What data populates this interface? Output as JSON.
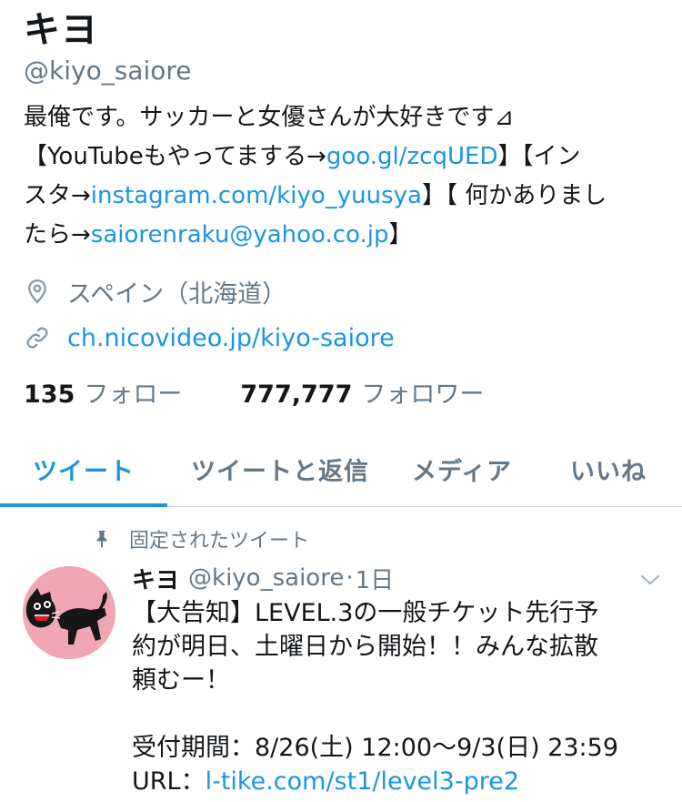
{
  "profile": {
    "display_name": "キヨ",
    "handle": "@kiyo_saiore",
    "bio": {
      "line1": "最俺です。サッカーと女優さんが大好きです⊿",
      "line2_a": "【YouTubeもやってまする→",
      "line2_link": "goo.gl/zcqUED",
      "line2_b": "】【イン",
      "line3_a": "スタ→",
      "line3_link": "instagram.com/kiyo_yuusya",
      "line3_b": "】【 何かありまし",
      "line4_a": "たら→",
      "line4_link": "saiorenraku@yahoo.co.jp",
      "line4_b": "】"
    },
    "location": "スペイン（北海道）",
    "location_icon": "location-pin-icon",
    "website": "ch.nicovideo.jp/kiyo-saiore",
    "website_icon": "link-icon",
    "following_count": "135",
    "following_label": "フォロー",
    "followers_count": "777,777",
    "followers_label": "フォロワー"
  },
  "tabs": [
    {
      "label": "ツイート",
      "active": true
    },
    {
      "label": "ツイートと返信",
      "active": false
    },
    {
      "label": "メディア",
      "active": false
    },
    {
      "label": "いいね",
      "active": false
    }
  ],
  "pinned": {
    "label": "固定されたツイート",
    "icon": "pin-icon"
  },
  "tweet": {
    "name": "キヨ",
    "handle": "@kiyo_saiore",
    "separator": "·",
    "time": "1日",
    "text": {
      "line1": "【大告知】LEVEL.3の一般チケット先行予",
      "line2": "約が明日、土曜日から開始！！みんな拡散",
      "line3": "頼むー！",
      "line5": "受付期間：8/26(土) 12:00〜9/3(日) 23:59",
      "line6_a": "URL：",
      "line6_link": "l-tike.com/st1/level3-pre2"
    }
  },
  "colors": {
    "accent": "#1b95e0",
    "secondary_text": "#657786",
    "primary_text": "#14171a",
    "divider": "#ccd6dd",
    "avatar_bg": "#f0a6b4"
  }
}
